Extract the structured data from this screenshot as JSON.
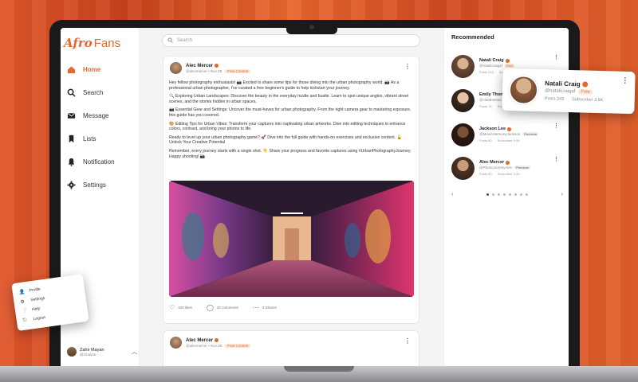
{
  "app": {
    "logo_part1": "Afro",
    "logo_part2": "Fans"
  },
  "nav": [
    {
      "label": "Home",
      "icon": "home-icon"
    },
    {
      "label": "Search",
      "icon": "search-icon"
    },
    {
      "label": "Message",
      "icon": "message-icon"
    },
    {
      "label": "Lists",
      "icon": "bookmark-icon"
    },
    {
      "label": "Notification",
      "icon": "bell-icon"
    },
    {
      "label": "Settings",
      "icon": "gear-icon"
    }
  ],
  "current_user": {
    "name": "Zahir Mayan",
    "handle": "@zmayan"
  },
  "search": {
    "placeholder": "Search"
  },
  "post1": {
    "author": "Alec Mercer",
    "handle": "@alecmercer",
    "time": "Nov 28",
    "badge": "Free Content",
    "paragraphs": [
      "Hey fellow photography enthusiasts! 📷 Excited to share some tips for those diving into the urban photography world. 📸 As a professional urban photographer, I've curated a free beginner's guide to help kickstart your journey.",
      "🔍 Exploring Urban Landscapes: Discover the beauty in the everyday hustle and bustle. Learn to spot unique angles, vibrant street scenes, and the stories hidden in urban spaces.",
      "📷 Essential Gear and Settings: Uncover the must-haves for urban photography. From the right camera gear to mastering exposure, this guide has you covered.",
      "🎨 Editing Tips for Urban Vibes: Transform your captures into captivating urban artworks. Dive into editing techniques to enhance colors, contrast, and bring your photos to life.",
      "Ready to level up your urban photography game? 🚀 Dive into the full guide with hands-on exercises and exclusive content. 🔓 Unlock Your Creative Potential",
      "Remember, every journey starts with a single shot. 👇 Share your progress and favorite captures using #UrbanPhotographyJourney. Happy shooting! 📸"
    ],
    "likes": "100 likes",
    "comments": "20 comments",
    "shares": "3 Shares"
  },
  "post2": {
    "author": "Alec Mercer",
    "handle": "@alecmercer",
    "time": "Nov 28",
    "badge": "Free Content"
  },
  "recommended": {
    "title": "Recommended",
    "items": [
      {
        "name": "Natali Craig",
        "handle": "@natalicraigaf",
        "badge": "Free",
        "posts": "Posts 243",
        "subs": "Subscriber 3.6K"
      },
      {
        "name": "Emily Thomas",
        "handle": "@clubthomas",
        "badge": "",
        "posts": "Posts 76",
        "subs": "Subscriber"
      },
      {
        "name": "Jackson Lee",
        "handle": "@MusicHarmonyJackson",
        "badge": "Premium",
        "posts": "Posts 80",
        "subs": "Subscriber 5.9K"
      },
      {
        "name": "Alec Mercer",
        "handle": "@PhotoJourneyAlec",
        "badge": "Premium",
        "posts": "Posts 60",
        "subs": "Subscriber 4.5K"
      }
    ]
  },
  "popup_card": {
    "name": "Natali Craig",
    "handle": "@natalicraigaf",
    "badge": "Free",
    "posts": "Posts 243",
    "subs": "Subscriber 3.6K"
  },
  "profile_menu": [
    "Profile",
    "Settings",
    "Help",
    "Logout"
  ],
  "colors": {
    "accent": "#e8672e"
  }
}
